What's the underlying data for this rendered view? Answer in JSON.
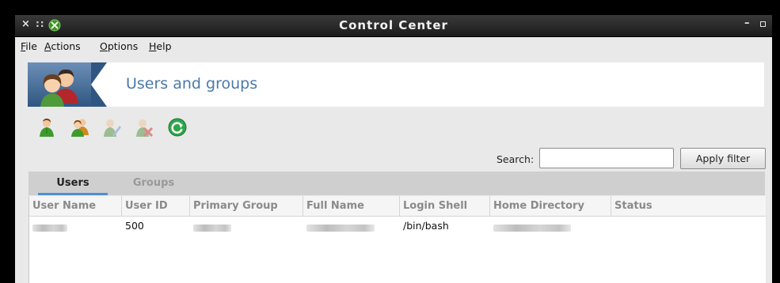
{
  "window": {
    "title": "Control Center",
    "close_glyph": "×",
    "grip_glyph": "::",
    "minimize_glyph": "–",
    "logo_icon": "xfce-logo-icon"
  },
  "menubar": {
    "items": [
      {
        "label": "File",
        "mnemonic": "F",
        "rest": "ile"
      },
      {
        "label": "Actions",
        "mnemonic": "A",
        "rest": "ctions"
      },
      {
        "label": "Options",
        "mnemonic": "O",
        "rest": "ptions"
      },
      {
        "label": "Help",
        "mnemonic": "H",
        "rest": "elp"
      }
    ]
  },
  "header": {
    "title": "Users and groups",
    "icon": "users-groups-icon"
  },
  "toolbar": {
    "icons": [
      "add-user-icon",
      "add-group-icon",
      "edit-user-icon",
      "delete-user-icon",
      "refresh-icon"
    ]
  },
  "search": {
    "label": "Search:",
    "value": "",
    "placeholder": "",
    "apply_label": "Apply filter"
  },
  "tabs": [
    {
      "label": "Users",
      "active": true
    },
    {
      "label": "Groups",
      "active": false
    }
  ],
  "table": {
    "columns": [
      "User Name",
      "User ID",
      "Primary Group",
      "Full Name",
      "Login Shell",
      "Home Directory",
      "Status"
    ],
    "rows": [
      {
        "user_id": "500",
        "login_shell": "/bin/bash"
      }
    ]
  },
  "colors": {
    "accent": "#4d8ed6",
    "header_title": "#4a79aa",
    "titlebar": "#1b1b1b"
  }
}
